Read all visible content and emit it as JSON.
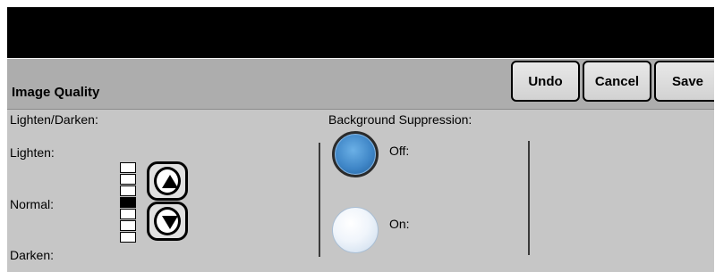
{
  "header": {
    "title": "Image Quality",
    "buttons": {
      "undo": "Undo",
      "cancel": "Cancel",
      "save": "Save"
    }
  },
  "lighten_darken": {
    "section_label": "Lighten/Darken:",
    "lighten_label": "Lighten:",
    "normal_label": "Normal:",
    "darken_label": "Darken:",
    "scale_steps": 7,
    "current_step": 4,
    "up_icon": "up-arrow-icon",
    "down_icon": "down-arrow-icon"
  },
  "background_suppression": {
    "section_label": "Background Suppression:",
    "options": [
      {
        "label": "Off:",
        "selected": true
      },
      {
        "label": "On:",
        "selected": false
      }
    ]
  },
  "colors": {
    "top_bar": "#000000",
    "header_bg": "#adadad",
    "panel_bg": "#c6c6c6",
    "selected_radio": "#3f86c7"
  }
}
